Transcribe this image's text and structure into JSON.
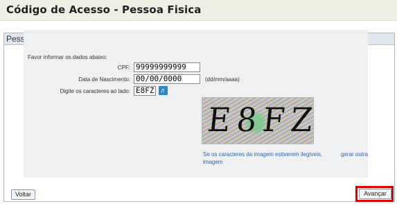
{
  "header": {
    "title": "Código de Acesso - Pessoa Fisica"
  },
  "panel": {
    "title": "Pessoa Fisica"
  },
  "form": {
    "intro": "Favor informar os dados abaixo:",
    "cpf": {
      "label": "CPF:",
      "value": "99999999999"
    },
    "birth": {
      "label": "Data de Nascimento:",
      "value": "00/00/0000",
      "hint": "(dd/mm/aaaa)"
    },
    "captcha": {
      "label": "Digite os caracteres ao lado:",
      "value": "E8FZ",
      "image_text": "E8FZ"
    },
    "captcha_help": "Se os caracteres da imagem estiverem ilegíveis,",
    "refresh_link_1": "gerar outra",
    "refresh_link_2": "imagem"
  },
  "buttons": {
    "back": "Voltar",
    "next": "Avançar"
  },
  "colors": {
    "highlight": "#e00000",
    "link": "#2f63a8",
    "panel_header": "#dfe6ee"
  },
  "icons": {
    "audio": "speaker-icon"
  }
}
